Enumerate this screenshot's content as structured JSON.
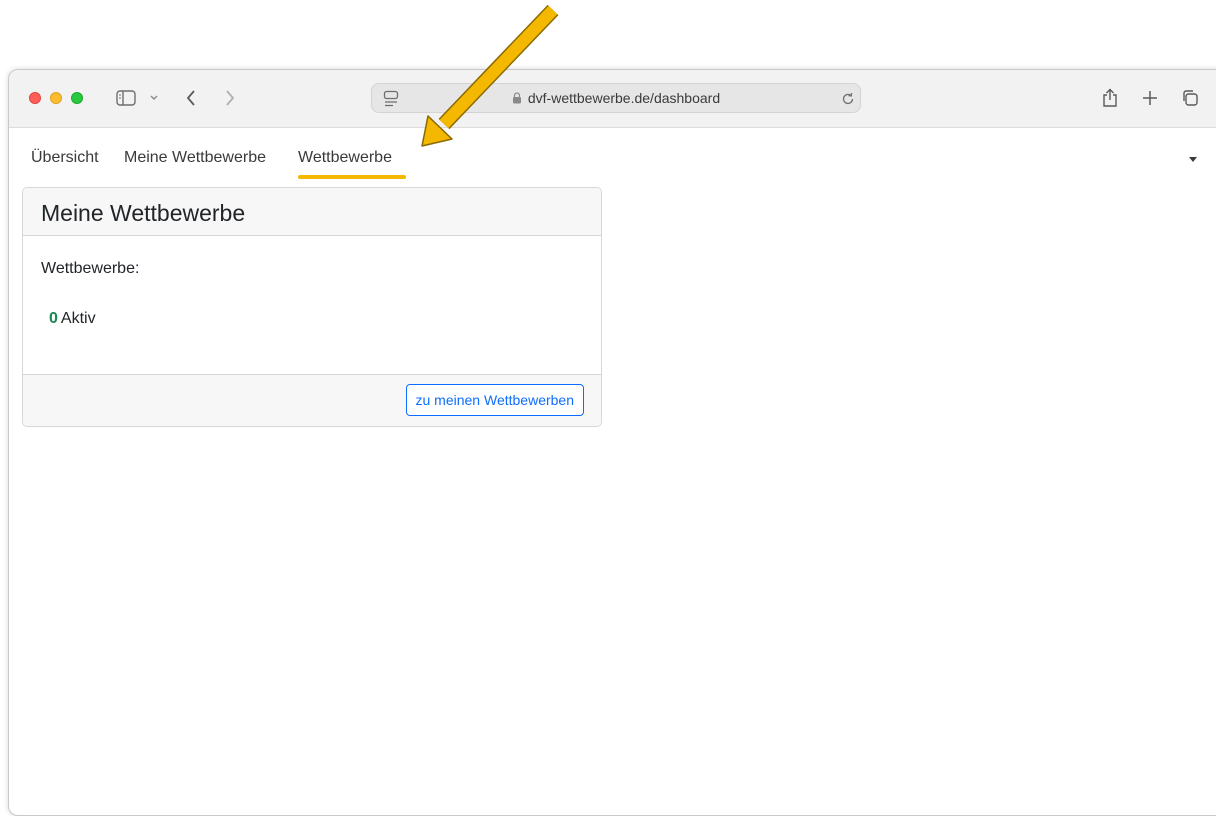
{
  "browser": {
    "url": "dvf-wettbewerbe.de/dashboard",
    "traffic_lights": [
      "close",
      "minimize",
      "zoom"
    ],
    "icons": [
      "sidebar-icon",
      "chevron-down-icon",
      "back-icon",
      "forward-icon",
      "reader-icon",
      "lock-icon",
      "reload-icon",
      "share-icon",
      "new-tab-icon",
      "tabs-overview-icon"
    ]
  },
  "nav": {
    "items": [
      {
        "label": "Übersicht"
      },
      {
        "label": "Meine Wettbewerbe"
      },
      {
        "label": "Wettbewerbe"
      }
    ],
    "highlighted_index": 2,
    "highlight_color": "#f5b800"
  },
  "card": {
    "title": "Meine Wettbewerbe",
    "label": "Wettbewerbe:",
    "count": "0",
    "count_label": "Aktiv",
    "count_color": "#198754",
    "button_label": "zu meinen Wettbewerben",
    "button_color": "#0d6efd"
  },
  "annotation": {
    "arrow_color": "#f5b800",
    "points_to": "Wettbewerbe"
  }
}
